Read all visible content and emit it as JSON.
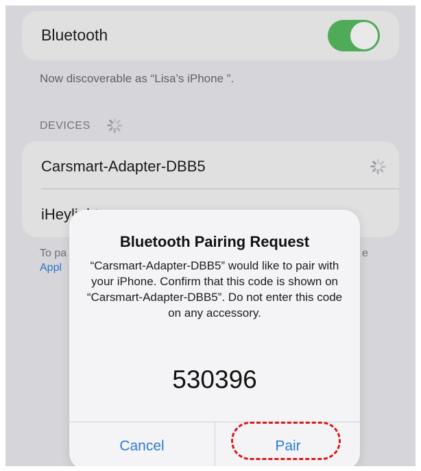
{
  "bluetooth": {
    "label": "Bluetooth",
    "enabled": true,
    "toggle_color": "#56b65f"
  },
  "discoverable_text": "Now discoverable as “Lisa’s iPhone ”.",
  "devices": {
    "header": "DEVICES",
    "items": [
      {
        "name": "Carsmart-Adapter-DBB5",
        "status": "connecting"
      },
      {
        "name": "iHeylight"
      }
    ]
  },
  "footer": {
    "prefix": "To pa",
    "link": "Appl",
    "suffix": "e"
  },
  "dialog": {
    "title": "Bluetooth Pairing Request",
    "message": "“Carsmart-Adapter-DBB5” would like to pair with your iPhone. Confirm that this code is shown on “Carsmart-Adapter-DBB5”. Do not enter this code on any accessory.",
    "code": "530396",
    "cancel_label": "Cancel",
    "pair_label": "Pair",
    "highlight_color": "#d81818"
  },
  "colors": {
    "accent": "#2e7ad1",
    "background": "#e3e3e8"
  }
}
